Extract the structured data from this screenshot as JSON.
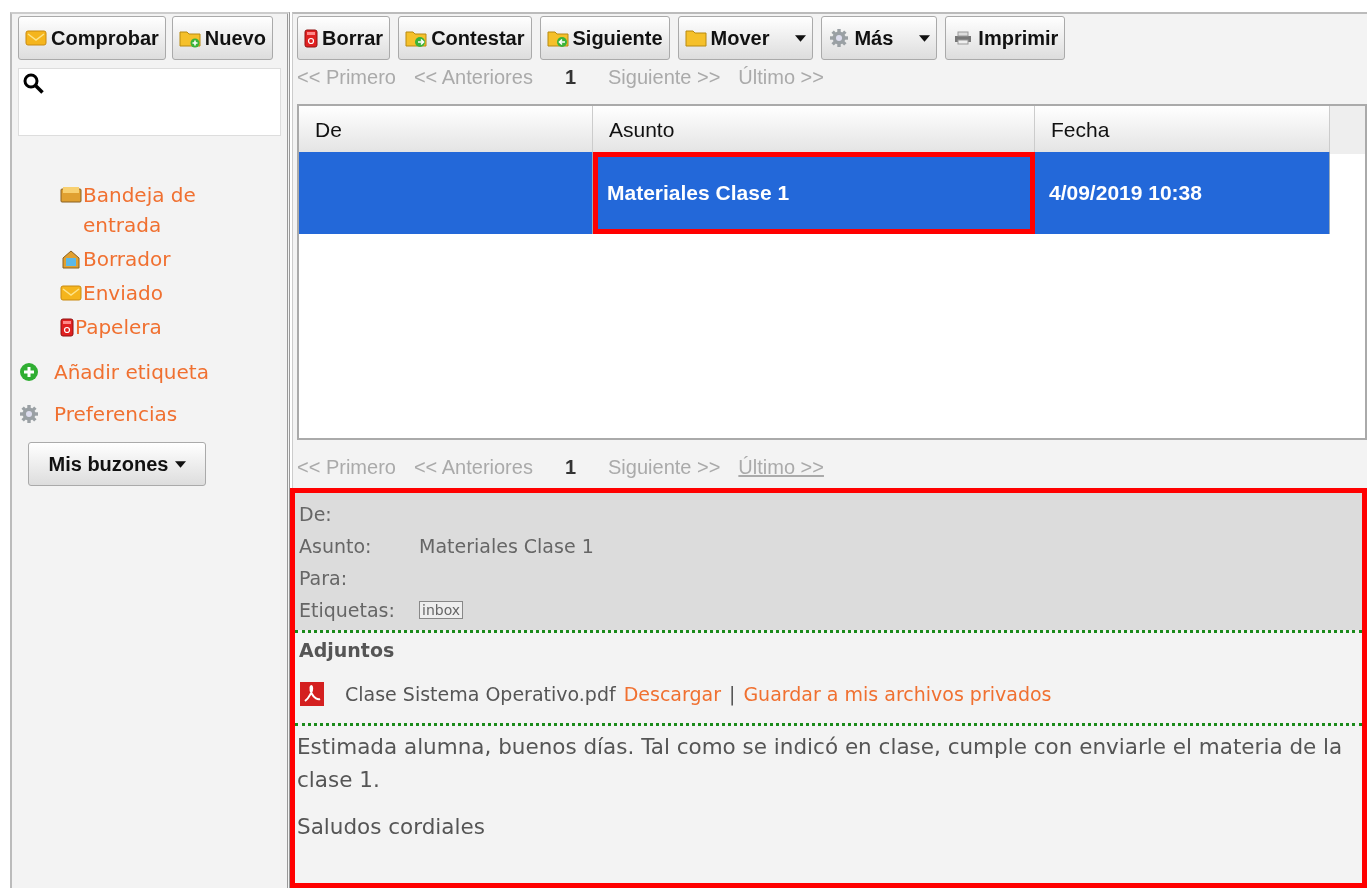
{
  "sidebar": {
    "buttons": [
      {
        "label": "Comprobar",
        "kind": "check"
      },
      {
        "label": "Nuevo",
        "kind": "new"
      }
    ],
    "folders": [
      {
        "label": "Bandeja de entrada",
        "kind": "inbox"
      },
      {
        "label": "Borrador",
        "kind": "draft"
      },
      {
        "label": "Enviado",
        "kind": "sent"
      },
      {
        "label": "Papelera",
        "kind": "trash"
      }
    ],
    "links": [
      {
        "label": "Añadir etiqueta",
        "kind": "add"
      },
      {
        "label": "Preferencias",
        "kind": "settings"
      }
    ],
    "mailboxes_button": {
      "label": "Mis buzones"
    }
  },
  "toolbar": [
    {
      "label": "Borrar",
      "kind": "delete",
      "dropdown": false
    },
    {
      "label": "Contestar",
      "kind": "reply",
      "dropdown": false
    },
    {
      "label": "Siguiente",
      "kind": "next",
      "dropdown": false
    },
    {
      "label": "Mover",
      "kind": "move",
      "dropdown": true
    },
    {
      "label": "Más",
      "kind": "more",
      "dropdown": true
    },
    {
      "label": "Imprimir",
      "kind": "print",
      "dropdown": false
    }
  ],
  "pager_top": [
    {
      "label": "<< Primero",
      "current": false,
      "hover": false
    },
    {
      "label": "<< Anteriores",
      "current": false,
      "hover": false
    },
    {
      "label": "1",
      "current": true,
      "hover": false
    },
    {
      "label": "Siguiente >>",
      "current": false,
      "hover": false
    },
    {
      "label": "Último >>",
      "current": false,
      "hover": false
    }
  ],
  "table": {
    "columns": [
      "De",
      "Asunto",
      "Fecha"
    ],
    "rows": [
      {
        "selected": true,
        "subject": "Materiales Clase 1",
        "subject_annotated": true,
        "date": "4/09/2019 10:38"
      }
    ]
  },
  "pager_bottom": [
    {
      "label": "<< Primero",
      "current": false,
      "hover": false
    },
    {
      "label": "<< Anteriores",
      "current": false,
      "hover": false
    },
    {
      "label": "1",
      "current": true,
      "hover": false
    },
    {
      "label": "Siguiente >>",
      "current": false,
      "hover": false
    },
    {
      "label": "Último >>",
      "current": false,
      "hover": true
    }
  ],
  "preview": {
    "annotated": true,
    "fields": [
      {
        "label": "De:"
      },
      {
        "label": "Asunto:",
        "value": "Materiales Clase 1"
      },
      {
        "label": "Para:"
      },
      {
        "label": "Etiquetas:",
        "tag": "inbox"
      }
    ],
    "attachments_title": "Adjuntos",
    "attachments": [
      {
        "name": "Clase Sistema Operativo.pdf",
        "download": "Descargar",
        "separator": "|",
        "save": "Guardar a mis archivos privados"
      }
    ],
    "body": [
      "Estimada alumna, buenos días. Tal como se indicó en clase, cumple con enviarle el materia de la clase 1.",
      "Saludos cordiales"
    ]
  }
}
